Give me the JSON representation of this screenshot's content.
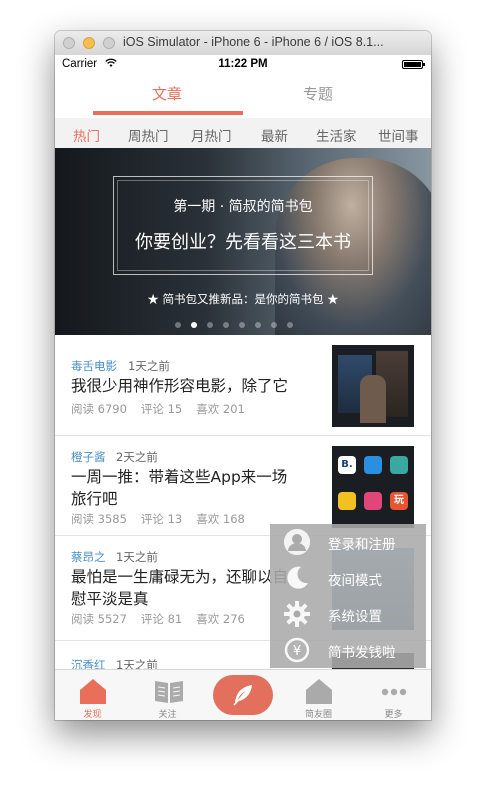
{
  "window": {
    "title": "iOS Simulator - iPhone 6 - iPhone 6 / iOS 8.1..."
  },
  "status_bar": {
    "carrier": "Carrier",
    "time": "11:22 PM"
  },
  "segment_tabs": [
    {
      "label": "文章",
      "active": true
    },
    {
      "label": "专题",
      "active": false
    }
  ],
  "categories": [
    "热门",
    "周热门",
    "月热门",
    "最新",
    "生活家",
    "世间事"
  ],
  "active_category": "热门",
  "banner": {
    "line1": "第一期 · 简叔的简书包",
    "line2": "你要创业？先看看这三本书",
    "line3": "★ 简书包又推新品：是你的简书包 ★",
    "page_count": 8,
    "active_page": 2
  },
  "articles": [
    {
      "author": "毒舌电影",
      "time": "1天之前",
      "title": "我很少用神作形容电影，除了它",
      "reads": "阅读 6790",
      "comments": "评论 15",
      "likes": "喜欢 201"
    },
    {
      "author": "橙子酱",
      "time": "2天之前",
      "title": "一周一推：带着这些App来一场旅行吧",
      "reads": "阅读 3585",
      "comments": "评论 13",
      "likes": "喜欢 168"
    },
    {
      "author": "蔡昂之",
      "time": "1天之前",
      "title": "最怕是一生庸碌无为，还聊以自慰平淡是真",
      "reads": "阅读 5527",
      "comments": "评论 81",
      "likes": "喜欢 276"
    },
    {
      "author": "沉香红",
      "time": "1天之前",
      "title": "",
      "reads": "",
      "comments": "",
      "likes": ""
    }
  ],
  "thumb2_apps": [
    "B.",
    "",
    "",
    "",
    "",
    "玩"
  ],
  "overlay_menu": [
    {
      "label": "登录和注册",
      "icon": "user-icon"
    },
    {
      "label": "夜间模式",
      "icon": "moon-icon"
    },
    {
      "label": "系统设置",
      "icon": "gear-icon"
    },
    {
      "label": "简书发钱啦",
      "icon": "yen-icon"
    }
  ],
  "tab_bar": [
    {
      "label": "发现",
      "icon": "home-icon",
      "active": true
    },
    {
      "label": "关注",
      "icon": "book-icon",
      "active": false
    },
    {
      "label": "",
      "icon": "feather-icon",
      "active": false
    },
    {
      "label": "简友圈",
      "icon": "house-icon",
      "active": false
    },
    {
      "label": "更多",
      "icon": "more-icon",
      "active": false
    }
  ],
  "colors": {
    "accent": "#ea6f5a",
    "author": "#4a90c8"
  }
}
